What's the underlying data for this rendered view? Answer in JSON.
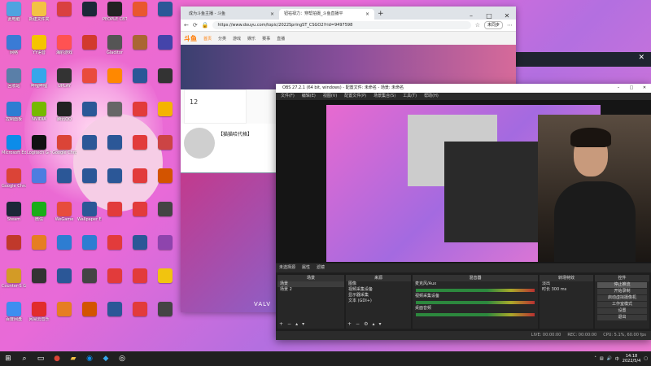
{
  "desktop": {
    "icons": [
      {
        "label": "此电脑",
        "color": "#4fa3e0"
      },
      {
        "label": "新建文件夹",
        "color": "#f3c244"
      },
      {
        "label": "",
        "color": "#d94040"
      },
      {
        "label": "",
        "color": "#1b2838"
      },
      {
        "label": "PEOPLE CBT",
        "color": "#222"
      },
      {
        "label": "",
        "color": "#e9572f"
      },
      {
        "label": "",
        "color": "#2b5797"
      },
      {
        "label": "网络",
        "color": "#3a7bd5"
      },
      {
        "label": "YY语音",
        "color": "#f5c400"
      },
      {
        "label": "海豹游戏",
        "color": "#ff5252"
      },
      {
        "label": "",
        "color": "#d23a2e"
      },
      {
        "label": "Gladitor",
        "color": "#555"
      },
      {
        "label": "",
        "color": "#aa6633"
      },
      {
        "label": "",
        "color": "#4444aa"
      },
      {
        "label": "回收站",
        "color": "#5a7fa8"
      },
      {
        "label": "哔哩哔哩",
        "color": "#36a6ea"
      },
      {
        "label": "UPLAY",
        "color": "#333"
      },
      {
        "label": "",
        "color": "#e94b3c"
      },
      {
        "label": "",
        "color": "#ff8800"
      },
      {
        "label": "",
        "color": "#2b5797"
      },
      {
        "label": "",
        "color": "#333"
      },
      {
        "label": "控制面板",
        "color": "#2d7dd2"
      },
      {
        "label": "NVIDIA",
        "color": "#76b900"
      },
      {
        "label": "腾讯QQ",
        "color": "#222"
      },
      {
        "label": "",
        "color": "#2b5797"
      },
      {
        "label": "",
        "color": "#666"
      },
      {
        "label": "",
        "color": "#e23b3b"
      },
      {
        "label": "",
        "color": "#f4b400"
      },
      {
        "label": "Microsoft Edge",
        "color": "#0c8ce9"
      },
      {
        "label": "Logitech G HUB",
        "color": "#111"
      },
      {
        "label": "Google Chrome",
        "color": "#db4437"
      },
      {
        "label": "",
        "color": "#2b5797"
      },
      {
        "label": "",
        "color": "#2b5797"
      },
      {
        "label": "",
        "color": "#e23b3b"
      },
      {
        "label": "",
        "color": "#c44"
      },
      {
        "label": "Google Chrome",
        "color": "#db4437"
      },
      {
        "label": "",
        "color": "#4d7de0"
      },
      {
        "label": "",
        "color": "#2b5797"
      },
      {
        "label": "",
        "color": "#2b5797"
      },
      {
        "label": "",
        "color": "#2b5797"
      },
      {
        "label": "",
        "color": "#e23b3b"
      },
      {
        "label": "",
        "color": "#d35400"
      },
      {
        "label": "Steam",
        "color": "#1b2838"
      },
      {
        "label": "微信",
        "color": "#1aad19"
      },
      {
        "label": "WeGame",
        "color": "#e74c3c"
      },
      {
        "label": "Wallpaper Engine",
        "color": "#2b5797"
      },
      {
        "label": "",
        "color": "#e23b3b"
      },
      {
        "label": "",
        "color": "#e23b3b"
      },
      {
        "label": "",
        "color": "#444"
      },
      {
        "label": "",
        "color": "#c0392b"
      },
      {
        "label": "",
        "color": "#e67e22"
      },
      {
        "label": "",
        "color": "#2d7dd2"
      },
      {
        "label": "",
        "color": "#2d7dd2"
      },
      {
        "label": "",
        "color": "#e23b3b"
      },
      {
        "label": "",
        "color": "#2b5797"
      },
      {
        "label": "",
        "color": "#8e44ad"
      },
      {
        "label": "Counter-S Global Off",
        "color": "#d39b26"
      },
      {
        "label": "",
        "color": "#333"
      },
      {
        "label": "",
        "color": "#2b5797"
      },
      {
        "label": "",
        "color": "#444"
      },
      {
        "label": "",
        "color": "#e23b3b"
      },
      {
        "label": "",
        "color": "#e23b3b"
      },
      {
        "label": "",
        "color": "#f1c40f"
      },
      {
        "label": "百度网盘",
        "color": "#3d8ef0"
      },
      {
        "label": "网易云音乐",
        "color": "#e12c2c"
      },
      {
        "label": "",
        "color": "#e67e22"
      },
      {
        "label": "",
        "color": "#d35400"
      },
      {
        "label": "",
        "color": "#2b5797"
      },
      {
        "label": "",
        "color": "#e23b3b"
      },
      {
        "label": "",
        "color": "#444"
      }
    ]
  },
  "browser": {
    "tabs": [
      {
        "label": "成为斗鱼主播 - 斗鱼"
      },
      {
        "label": "钮祜禄力：穿帮拍摄_斗鱼直播平"
      }
    ],
    "url": "https://www.douyu.com/topic/2022SpringST_CSGO2?rid=9497598",
    "sync_label": "未同步",
    "site": {
      "logo": "斗鱼",
      "menu": [
        "首页",
        "分类",
        "游戏",
        "娱乐",
        "赛事",
        "直播"
      ],
      "room_number": "12",
      "streamer_title": "【猫猫哈代格】",
      "video_caption": "VALV"
    }
  },
  "obs": {
    "title": "OBS 27.2.1 (64 bit, windows) - 配置文件: 未命名 - 场景: 未命名",
    "menu": [
      "文件(F)",
      "编辑(E)",
      "视图(V)",
      "配置文件(P)",
      "场景集合(S)",
      "工具(T)",
      "帮助(H)"
    ],
    "scene_header": [
      "未选择源",
      "属性",
      "滤镜"
    ],
    "docks": {
      "scenes": {
        "title": "场景",
        "items": [
          "场景",
          "场景 2"
        ]
      },
      "sources": {
        "title": "来源",
        "items": [
          "图像",
          "视频采集设备",
          "显示器采集",
          "文本 (GDI+)"
        ]
      },
      "mixer": {
        "title": "混音器",
        "channels": [
          "麦克风/Aux",
          "视频采集设备",
          "桌面音频"
        ]
      },
      "transitions": {
        "title": "转场特效",
        "type": "淡出",
        "duration_label": "时长",
        "duration": "300 ms"
      },
      "controls": {
        "title": "控件",
        "buttons": [
          "停止推流",
          "开始录制",
          "启动虚拟摄像机",
          "工作室模式",
          "设置",
          "退出"
        ]
      }
    },
    "status": [
      "LIVE: 00:00:00",
      "REC: 00:00:00",
      "CPU: 5.1%, 60.00 fps"
    ]
  },
  "taskbar": {
    "time": "14:18",
    "date": "2022/5/4",
    "lang": "中"
  }
}
